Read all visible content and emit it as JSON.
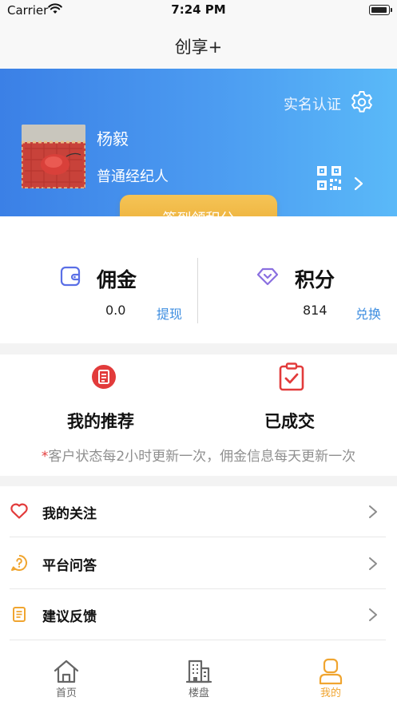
{
  "status_bar": {
    "carrier": "Carrier",
    "time": "7:24 PM"
  },
  "navbar": {
    "title": "创享+"
  },
  "profile": {
    "verify_label": "实名认证",
    "name": "杨毅",
    "role": "普通经纪人"
  },
  "checkin": {
    "label": "签到领积分"
  },
  "wallet": {
    "commission": {
      "title": "佣金",
      "amount": "0.0",
      "action": "提现"
    },
    "points": {
      "title": "积分",
      "amount": "814",
      "action": "兑换"
    }
  },
  "orders": {
    "items": [
      {
        "label": "我的推荐",
        "icon": "recommend-icon"
      },
      {
        "label": "已成交",
        "icon": "clipboard-check-icon"
      }
    ],
    "note_star": "*",
    "note": "客户状态每2小时更新一次，佣金信息每天更新一次"
  },
  "menu": {
    "items": [
      {
        "label": "我的关注",
        "icon": "heart-icon"
      },
      {
        "label": "平台问答",
        "icon": "question-icon"
      },
      {
        "label": "建议反馈",
        "icon": "feedback-icon"
      }
    ]
  },
  "tabbar": {
    "items": [
      {
        "label": "首页",
        "icon": "home-icon",
        "active": false
      },
      {
        "label": "楼盘",
        "icon": "building-icon",
        "active": false
      },
      {
        "label": "我的",
        "icon": "person-icon",
        "active": true
      }
    ]
  },
  "colors": {
    "hero_gradient_start": "#3b80e6",
    "hero_gradient_end": "#5ab9f8",
    "accent_orange": "#f0a530",
    "link_blue": "#3d8de0",
    "icon_red": "#e23b3b",
    "icon_purple": "#8a6fe0"
  }
}
